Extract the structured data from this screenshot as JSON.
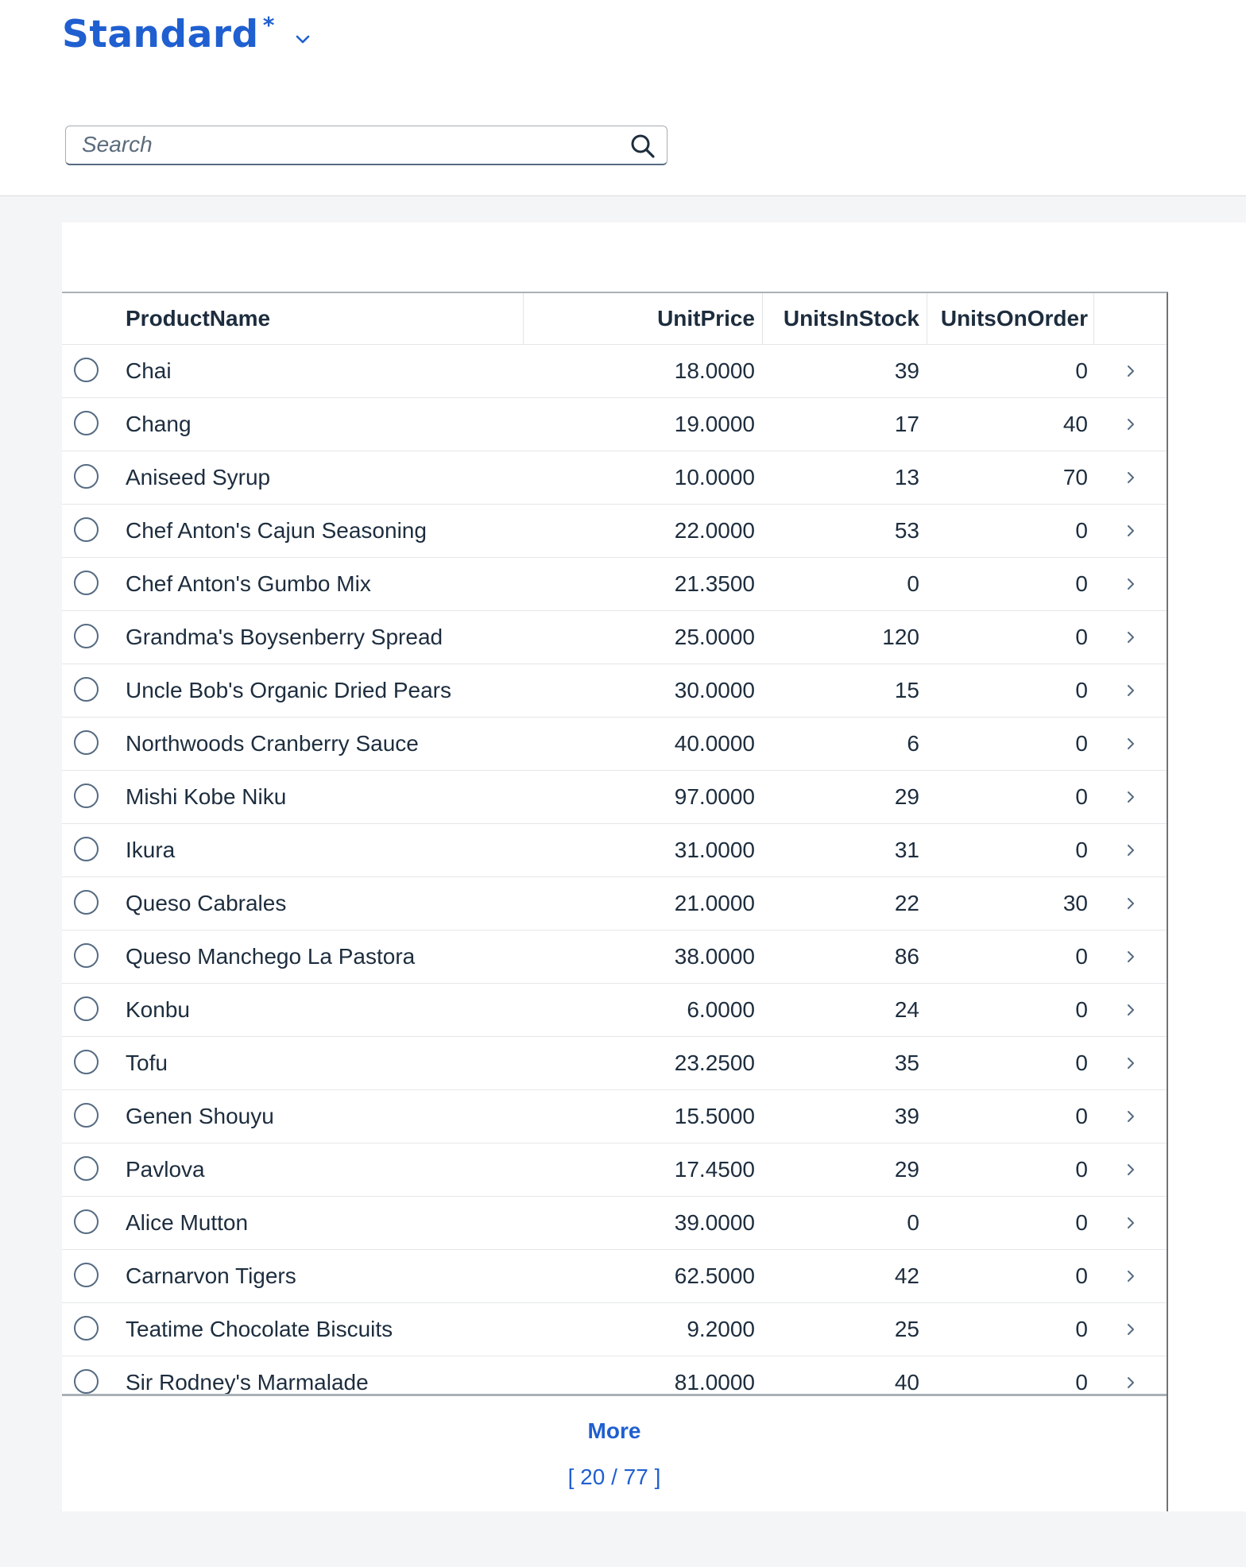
{
  "variant": {
    "title": "Standard",
    "modified_marker": "*"
  },
  "search": {
    "placeholder": "Search"
  },
  "table": {
    "columns": [
      "ProductName",
      "UnitPrice",
      "UnitsInStock",
      "UnitsOnOrder"
    ],
    "rows": [
      {
        "name": "Chai",
        "price": "18.0000",
        "stock": "39",
        "order": "0"
      },
      {
        "name": "Chang",
        "price": "19.0000",
        "stock": "17",
        "order": "40"
      },
      {
        "name": "Aniseed Syrup",
        "price": "10.0000",
        "stock": "13",
        "order": "70"
      },
      {
        "name": "Chef Anton's Cajun Seasoning",
        "price": "22.0000",
        "stock": "53",
        "order": "0"
      },
      {
        "name": "Chef Anton's Gumbo Mix",
        "price": "21.3500",
        "stock": "0",
        "order": "0"
      },
      {
        "name": "Grandma's Boysenberry Spread",
        "price": "25.0000",
        "stock": "120",
        "order": "0"
      },
      {
        "name": "Uncle Bob's Organic Dried Pears",
        "price": "30.0000",
        "stock": "15",
        "order": "0"
      },
      {
        "name": "Northwoods Cranberry Sauce",
        "price": "40.0000",
        "stock": "6",
        "order": "0"
      },
      {
        "name": "Mishi Kobe Niku",
        "price": "97.0000",
        "stock": "29",
        "order": "0"
      },
      {
        "name": "Ikura",
        "price": "31.0000",
        "stock": "31",
        "order": "0"
      },
      {
        "name": "Queso Cabrales",
        "price": "21.0000",
        "stock": "22",
        "order": "30"
      },
      {
        "name": "Queso Manchego La Pastora",
        "price": "38.0000",
        "stock": "86",
        "order": "0"
      },
      {
        "name": "Konbu",
        "price": "6.0000",
        "stock": "24",
        "order": "0"
      },
      {
        "name": "Tofu",
        "price": "23.2500",
        "stock": "35",
        "order": "0"
      },
      {
        "name": "Genen Shouyu",
        "price": "15.5000",
        "stock": "39",
        "order": "0"
      },
      {
        "name": "Pavlova",
        "price": "17.4500",
        "stock": "29",
        "order": "0"
      },
      {
        "name": "Alice Mutton",
        "price": "39.0000",
        "stock": "0",
        "order": "0"
      },
      {
        "name": "Carnarvon Tigers",
        "price": "62.5000",
        "stock": "42",
        "order": "0"
      },
      {
        "name": "Teatime Chocolate Biscuits",
        "price": "9.2000",
        "stock": "25",
        "order": "0"
      },
      {
        "name": "Sir Rodney's Marmalade",
        "price": "81.0000",
        "stock": "40",
        "order": "0"
      }
    ]
  },
  "footer": {
    "more_label": "More",
    "count_text": "[ 20 / 77 ]"
  },
  "colors": {
    "accent": "#1f5fd0",
    "text": "#1d2d3e",
    "background": "#f4f5f6"
  }
}
